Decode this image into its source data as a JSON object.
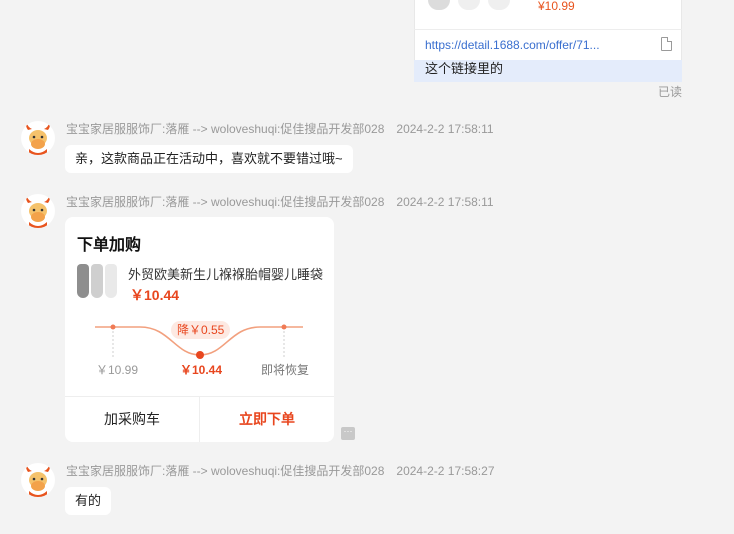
{
  "top_message": {
    "price": "¥10.99",
    "link": "https://detail.1688.com/offer/71...",
    "text": "这个链接里的",
    "status": "已读"
  },
  "messages": [
    {
      "sender": "宝宝家居服服饰厂:落雁 --> woloveshuqi:促佳搜品开发部028",
      "time": "2024-2-2 17:58:11",
      "text": "亲，这款商品正在活动中，喜欢就不要错过哦~"
    },
    {
      "sender": "宝宝家居服服饰厂:落雁 --> woloveshuqi:促佳搜品开发部028",
      "time": "2024-2-2 17:58:11"
    },
    {
      "sender": "宝宝家居服服饰厂:落雁 --> woloveshuqi:促佳搜品开发部028",
      "time": "2024-2-2 17:58:27",
      "text": "有的"
    }
  ],
  "order_card": {
    "title": "下单加购",
    "product_name": "外贸欧美新生儿褓褓胎帽婴儿睡袋",
    "price": "￥10.44",
    "drop_badge": "降￥0.55",
    "old_price": "￥10.99",
    "current_price": "￥10.44",
    "restore_label": "即将恢复",
    "add_cart": "加采购车",
    "buy_now": "立即下单"
  },
  "icons": {
    "avatar": "cow-avatar-icon",
    "doc": "document-icon",
    "more": "more-dots-icon"
  },
  "colors": {
    "accent": "#e8461e",
    "link": "#3a6fcf",
    "outgoing_bubble": "#e4ecfb"
  }
}
